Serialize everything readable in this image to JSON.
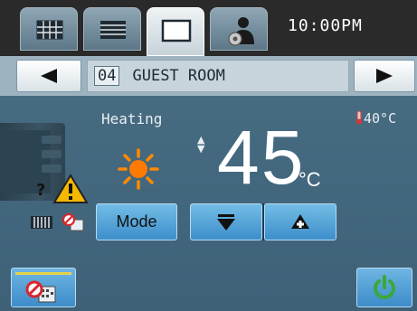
{
  "header": {
    "time": "10:00PM",
    "tabs": [
      {
        "name": "grid-view",
        "icon": "grid-icon",
        "active": false
      },
      {
        "name": "list-view",
        "icon": "list-icon",
        "active": false
      },
      {
        "name": "single-view",
        "icon": "square-icon",
        "active": true
      },
      {
        "name": "user-settings",
        "icon": "user-gear-icon",
        "active": false
      }
    ]
  },
  "room": {
    "number": "04",
    "name": "GUEST ROOM",
    "prev_icon": "left-arrow-icon",
    "next_icon": "right-arrow-icon"
  },
  "status": {
    "mode": "Heating",
    "mode_icon": "sun-icon",
    "outdoor_temp": "40°C",
    "setpoint": "45",
    "unit": "°C"
  },
  "controls": {
    "mode_label": "Mode",
    "down_icon": "down-triangle-icon",
    "up_icon": "up-triangle-icon",
    "power_icon": "power-icon"
  },
  "colors": {
    "background": "#456a80",
    "button": "#4f9fd6",
    "warning": "#f5b800",
    "sun": "#ff8a00",
    "power": "#3aa83a"
  }
}
